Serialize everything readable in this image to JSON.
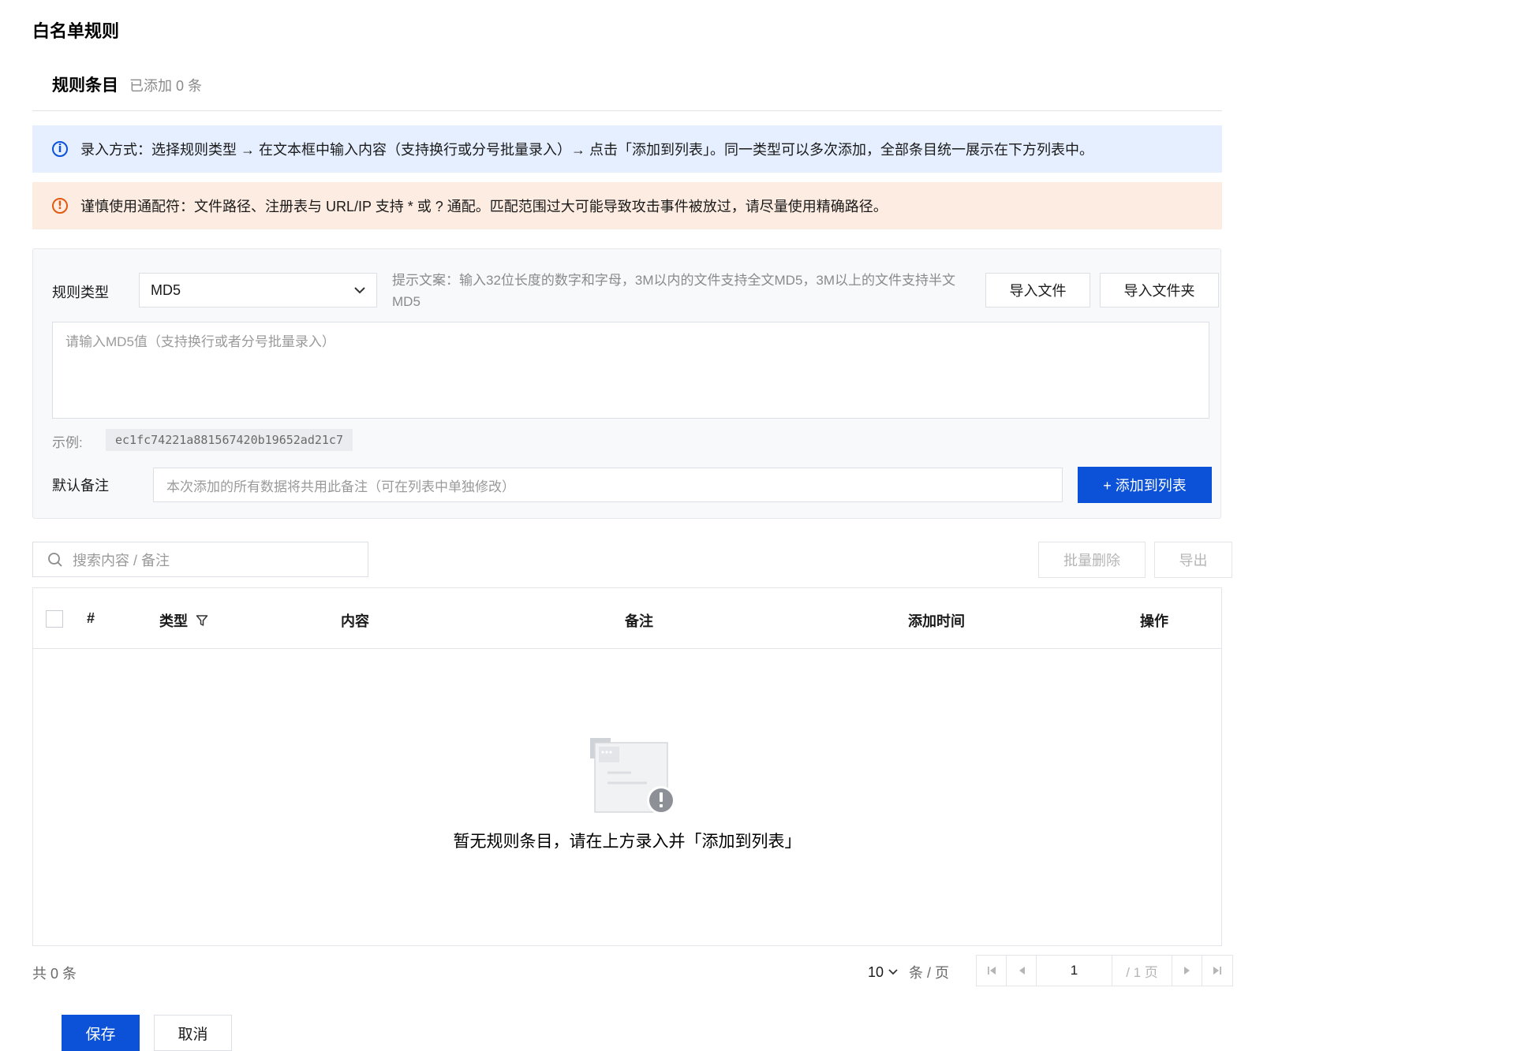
{
  "page": {
    "title": "白名单规则"
  },
  "section": {
    "title": "规则条目",
    "count_text": "已添加 0 条"
  },
  "alerts": {
    "info": "录入方式：选择规则类型 → 在文本框中输入内容（支持换行或分号批量录入）→ 点击「添加到列表」。同一类型可以多次添加，全部条目统一展示在下方列表中。",
    "warning": "谨慎使用通配符：文件路径、注册表与 URL/IP 支持 * 或 ? 通配。匹配范围过大可能导致攻击事件被放过，请尽量使用精确路径。"
  },
  "form": {
    "rule_type_label": "规则类型",
    "rule_type_value": "MD5",
    "hint": "提示文案：输入32位长度的数字和字母，3M以内的文件支持全文MD5，3M以上的文件支持半文MD5",
    "import_file": "导入文件",
    "import_folder": "导入文件夹",
    "textarea_placeholder": "请输入MD5值（支持换行或者分号批量录入）",
    "example_label": "示例:",
    "example_value": "ec1fc74221a881567420b19652ad21c7",
    "remark_label": "默认备注",
    "remark_placeholder": "本次添加的所有数据将共用此备注（可在列表中单独修改）",
    "add_button": "+ 添加到列表"
  },
  "toolbar": {
    "search_placeholder": "搜索内容 / 备注",
    "batch_delete": "批量删除",
    "export": "导出"
  },
  "table": {
    "columns": [
      "#",
      "类型",
      "内容",
      "备注",
      "添加时间",
      "操作"
    ],
    "empty_text": "暂无规则条目，请在上方录入并「添加到列表」"
  },
  "pagination": {
    "total": "共 0 条",
    "page_size": "10",
    "page_size_unit": "条 / 页",
    "current_page": "1",
    "total_pages": "/ 1 页"
  },
  "actions": {
    "save": "保存",
    "cancel": "取消"
  },
  "colors": {
    "primary": "#0b52d9",
    "info_bg": "#e5efff",
    "warning_bg": "#fdece1",
    "warning": "#e15a0f"
  }
}
